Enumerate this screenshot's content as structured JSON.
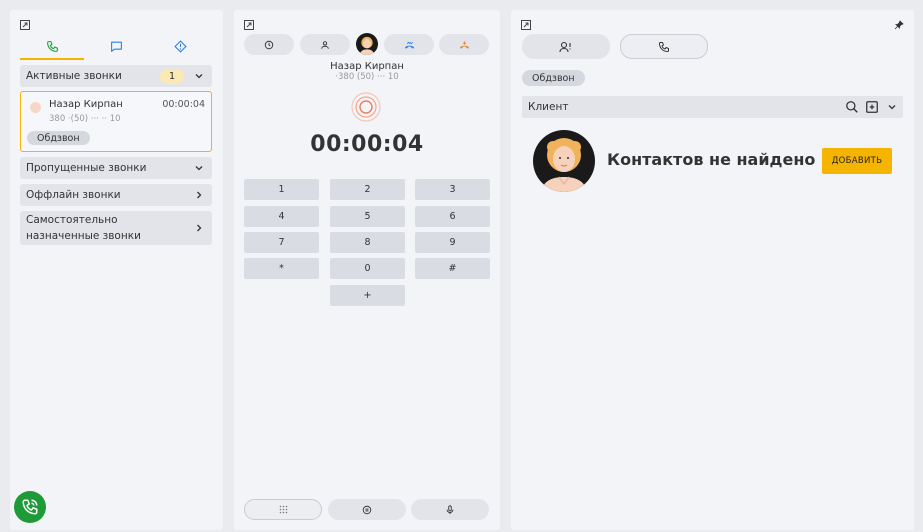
{
  "left": {
    "sections": {
      "active_label": "Активные звонки",
      "active_count": "1",
      "missed_label": "Пропущенные звонки",
      "offline_label": "Оффлайн звонки",
      "self_assigned_label": "Самостоятельно назначенные звонки"
    },
    "call_card": {
      "name": "Назар Кирпан",
      "time": "00:00:04",
      "phone": "380 ·(50) ··· ·· 10",
      "tag": "Обдзвон"
    }
  },
  "mid": {
    "caller_name": "Назар Кирпан",
    "caller_phone": "·380 (50) ··· 10",
    "timer": "00:00:04",
    "keys": [
      "1",
      "2",
      "3",
      "4",
      "5",
      "6",
      "7",
      "8",
      "9",
      "*",
      "0",
      "#",
      "+"
    ]
  },
  "right": {
    "tag": "Обдзвон",
    "client_label": "Клиент",
    "not_found_text": "Контактов не найдено",
    "add_button": "ДОБАВИТЬ"
  },
  "colors": {
    "accent": "#f5b400",
    "green": "#1e9b38",
    "blue_icon": "#2f7fe0",
    "orange_icon": "#e8862c"
  }
}
